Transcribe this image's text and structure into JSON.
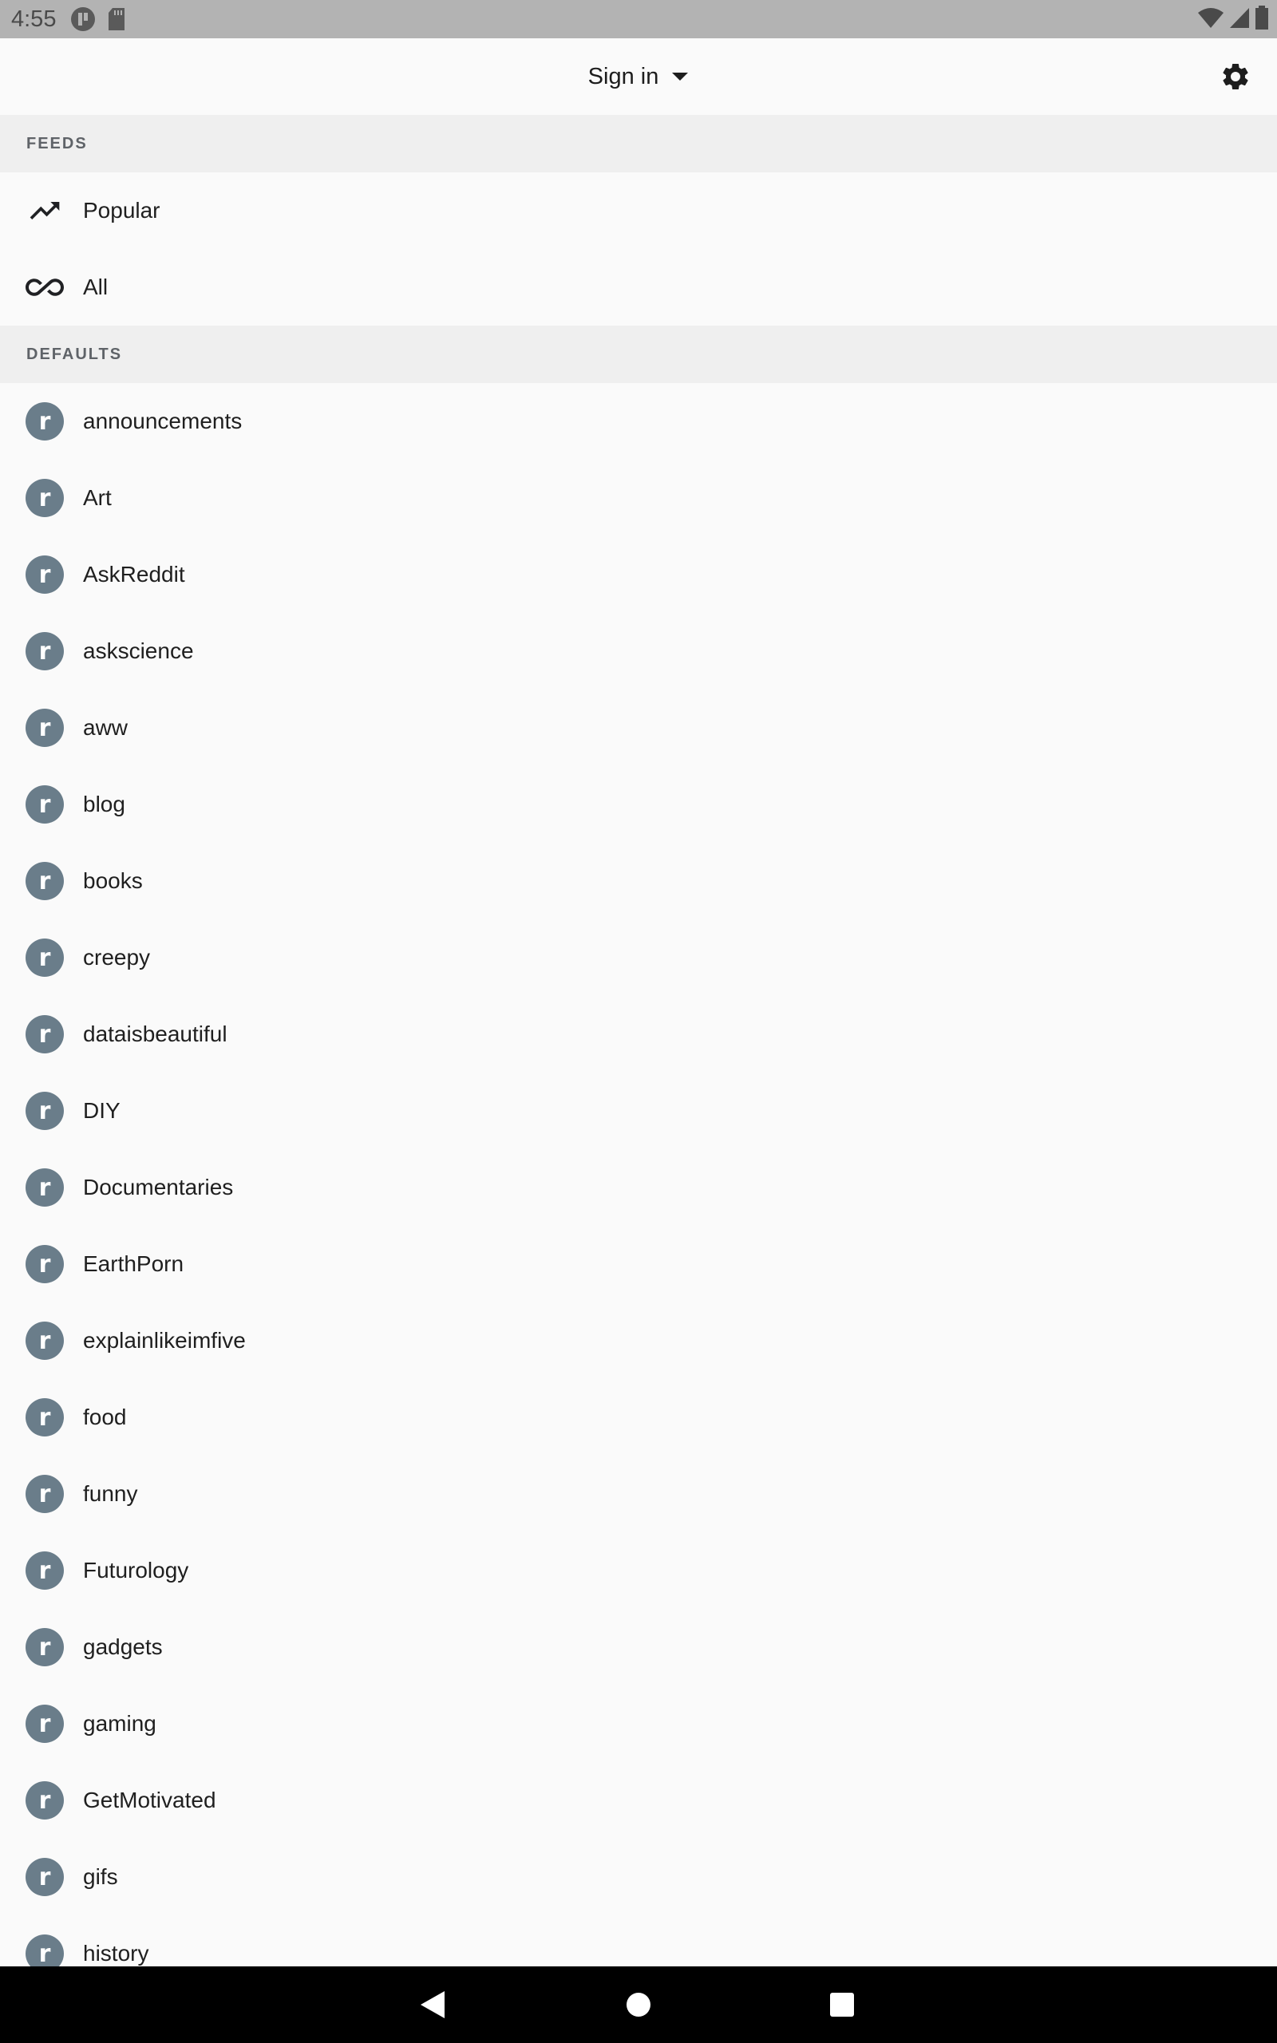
{
  "status_bar": {
    "time": "4:55"
  },
  "header": {
    "account_label": "Sign in",
    "settings_icon": "gear-icon"
  },
  "sections": {
    "feeds": "FEEDS",
    "defaults": "DEFAULTS"
  },
  "feeds": [
    {
      "label": "Popular",
      "icon": "trending-up-icon"
    },
    {
      "label": "All",
      "icon": "infinity-icon"
    }
  ],
  "subreddit_avatar_letter": "r",
  "subreddits": [
    "announcements",
    "Art",
    "AskReddit",
    "askscience",
    "aww",
    "blog",
    "books",
    "creepy",
    "dataisbeautiful",
    "DIY",
    "Documentaries",
    "EarthPorn",
    "explainlikeimfive",
    "food",
    "funny",
    "Futurology",
    "gadgets",
    "gaming",
    "GetMotivated",
    "gifs",
    "history"
  ],
  "colors": {
    "status_bar": "#b3b3b3",
    "background": "#fafafa",
    "section_header": "#efefef",
    "avatar": "#6a7d8a",
    "nav_bar": "#000000"
  }
}
